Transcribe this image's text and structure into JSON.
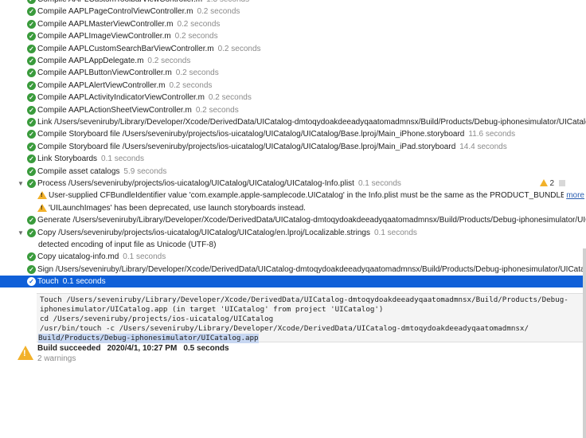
{
  "rows": [
    {
      "kind": "ok",
      "text": "Compile AAPLCustomToolbarViewController.m",
      "dur": "1.3 seconds"
    },
    {
      "kind": "ok",
      "text": "Compile AAPLPageControlViewController.m",
      "dur": "0.2 seconds"
    },
    {
      "kind": "ok",
      "text": "Compile AAPLMasterViewController.m",
      "dur": "0.2 seconds"
    },
    {
      "kind": "ok",
      "text": "Compile AAPLImageViewController.m",
      "dur": "0.2 seconds"
    },
    {
      "kind": "ok",
      "text": "Compile AAPLCustomSearchBarViewController.m",
      "dur": "0.2 seconds"
    },
    {
      "kind": "ok",
      "text": "Compile AAPLAppDelegate.m",
      "dur": "0.2 seconds"
    },
    {
      "kind": "ok",
      "text": "Compile AAPLButtonViewController.m",
      "dur": "0.2 seconds"
    },
    {
      "kind": "ok",
      "text": "Compile AAPLAlertViewController.m",
      "dur": "0.2 seconds"
    },
    {
      "kind": "ok",
      "text": "Compile AAPLActivityIndicatorViewController.m",
      "dur": "0.2 seconds"
    },
    {
      "kind": "ok",
      "text": "Compile AAPLActionSheetViewController.m",
      "dur": "0.2 seconds"
    },
    {
      "kind": "ok",
      "text": "Link /Users/seveniruby/Library/Developer/Xcode/DerivedData/UICatalog-dmtoqydoakdeeadyqaatomadmnsx/Build/Products/Debug-iphonesimulator/UICatalo...",
      "dur": ""
    },
    {
      "kind": "ok",
      "text": "Compile Storyboard file /Users/seveniruby/projects/ios-uicatalog/UICatalog/UICatalog/Base.lproj/Main_iPhone.storyboard",
      "dur": "11.6 seconds"
    },
    {
      "kind": "ok",
      "text": "Compile Storyboard file /Users/seveniruby/projects/ios-uicatalog/UICatalog/UICatalog/Base.lproj/Main_iPad.storyboard",
      "dur": "14.4 seconds"
    },
    {
      "kind": "ok",
      "text": "Link Storyboards",
      "dur": "0.1 seconds"
    },
    {
      "kind": "ok",
      "text": "Compile asset catalogs",
      "dur": "5.9 seconds"
    },
    {
      "kind": "process",
      "text": "Process /Users/seveniruby/projects/ios-uicatalog/UICatalog/UICatalog/UICatalog-Info.plist",
      "dur": "0.1 seconds",
      "badge": "2"
    },
    {
      "kind": "warn",
      "text": "User-supplied CFBundleIdentifier value 'com.example.apple-samplecode.UICatalog' in the Info.plist must be the same as the PRODUCT_BUNDLE_I...",
      "more": "more"
    },
    {
      "kind": "warn",
      "text": "'UILaunchImages' has been deprecated, use launch storyboards instead."
    },
    {
      "kind": "ok",
      "text": "Generate /Users/seveniruby/Library/Developer/Xcode/DerivedData/UICatalog-dmtoqydoakdeeadyqaatomadmnsx/Build/Products/Debug-iphonesimulator/UIC...",
      "dur": ""
    },
    {
      "kind": "process",
      "text": "Copy /Users/seveniruby/projects/ios-uicatalog/UICatalog/UICatalog/en.lproj/Localizable.strings",
      "dur": "0.1 seconds"
    },
    {
      "kind": "note",
      "text": "detected encoding of input file as Unicode (UTF-8)"
    },
    {
      "kind": "ok",
      "text": "Copy uicatalog-info.md",
      "dur": "0.1 seconds"
    },
    {
      "kind": "ok",
      "text": "Sign /Users/seveniruby/Library/Developer/Xcode/DerivedData/UICatalog-dmtoqydoakdeeadyqaatomadmnsx/Build/Products/Debug-iphonesimulator/UICatalo...",
      "dur": ""
    },
    {
      "kind": "selected",
      "text": "Touch",
      "dur": "0.1 seconds"
    }
  ],
  "transcript": [
    "Touch /Users/seveniruby/Library/Developer/Xcode/DerivedData/UICatalog-dmtoqydoakdeeadyqaatomadmnsx/Build/Products/Debug-",
    "    iphonesimulator/UICatalog.app (in target 'UICatalog' from project 'UICatalog')",
    "      cd /Users/seveniruby/projects/ios-uicatalog/UICatalog",
    "      /usr/bin/touch -c /Users/seveniruby/Library/Developer/Xcode/DerivedData/UICatalog-dmtoqydoakdeeadyqaatomadmnsx/",
    "Build/Products/Debug-iphonesimulator/UICatalog.app"
  ],
  "summary": {
    "status": "Build succeeded",
    "timestamp": "2020/4/1, 10:27 PM",
    "duration": "0.5 seconds",
    "warnings": "2 warnings"
  },
  "colors": {
    "selection": "#1060d8",
    "success": "#3a9b3c",
    "warning": "#f2b12a"
  }
}
